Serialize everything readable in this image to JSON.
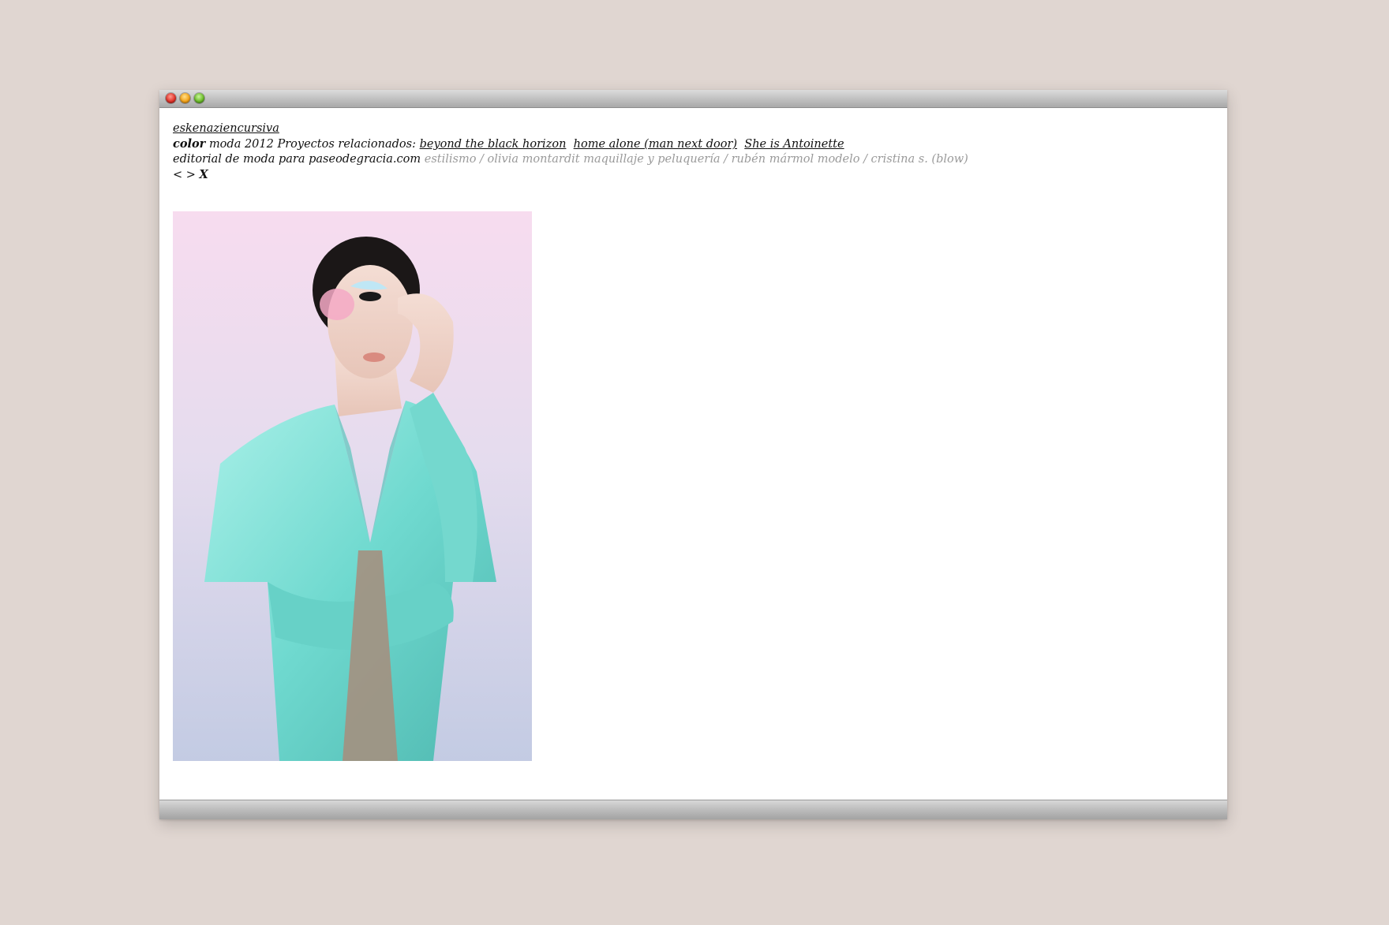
{
  "window": {
    "controls": [
      "close-icon",
      "minimize-icon",
      "zoom-icon"
    ]
  },
  "header": {
    "site_name": "eskenaziencursiva",
    "project_title": "color",
    "project_meta": "moda 2012 Proyectos relacionados:",
    "related_projects": [
      "beyond the black horizon",
      "home alone (man next door)",
      "She is Antoinette"
    ],
    "description": "editorial de moda para paseodegracia.com",
    "credits": "estilismo / olivia montardit maquillaje y peluquería / rubén mármol modelo / cristina s. (blow)"
  },
  "nav": {
    "prev": "<",
    "next": ">",
    "close": "X"
  },
  "photo": {
    "subject": "fashion-portrait"
  },
  "colors": {
    "page_background": "#e0d6d1",
    "text": "#111111",
    "muted_text": "#9a9a9a",
    "jacket": "#7ee0d6"
  }
}
